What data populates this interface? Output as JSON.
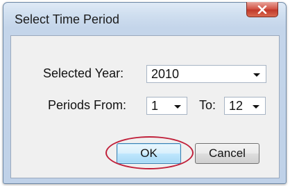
{
  "window": {
    "title": "Select Time Period",
    "close_icon": "close-x-icon"
  },
  "form": {
    "selected_year_label": "Selected Year:",
    "selected_year_value": "2010",
    "periods_from_label": "Periods From:",
    "periods_from_value": "1",
    "to_label": "To:",
    "to_value": "12"
  },
  "buttons": {
    "ok_label": "OK",
    "cancel_label": "Cancel"
  },
  "colors": {
    "title_bar": "#cfdeef",
    "close_button": "#c0392b",
    "highlight_annotation": "#c0203a",
    "ok_button_focus": "#3c7fb1"
  }
}
